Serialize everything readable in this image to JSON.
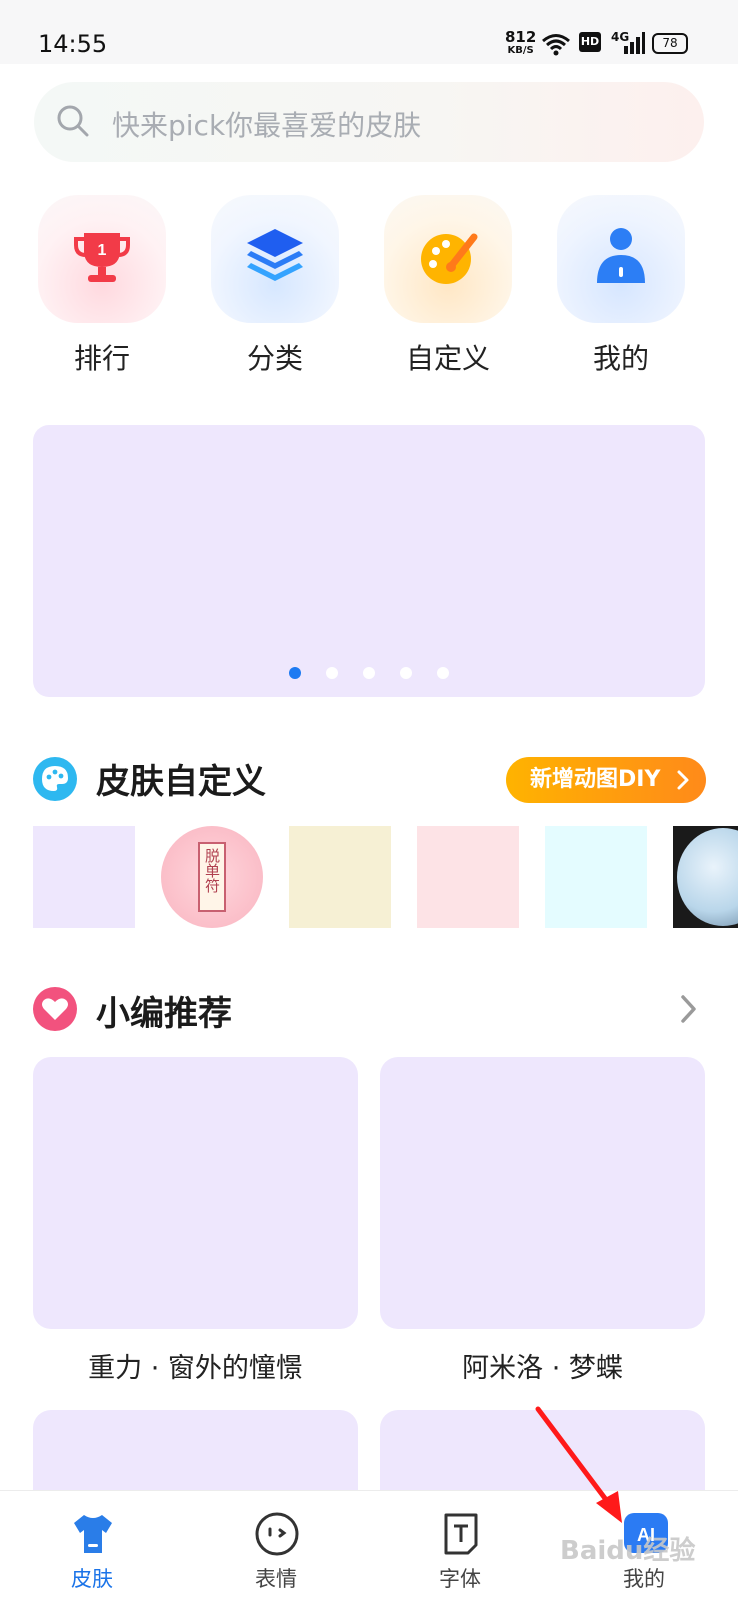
{
  "status": {
    "time": "14:55",
    "net_speed": "812",
    "net_speed_unit": "KB/S",
    "hd": "HD",
    "network": "4G",
    "battery": "78"
  },
  "search": {
    "placeholder": "快来pick你最喜爱的皮肤"
  },
  "quick_entries": [
    {
      "label": "排行",
      "icon": "trophy-icon"
    },
    {
      "label": "分类",
      "icon": "layers-icon"
    },
    {
      "label": "自定义",
      "icon": "palette-icon"
    },
    {
      "label": "我的",
      "icon": "person-icon"
    }
  ],
  "banner": {
    "page_count": 5,
    "active_index": 0
  },
  "section_diy": {
    "title": "皮肤自定义",
    "action_label": "新增动图DIY",
    "skins": [
      {
        "text": ""
      },
      {
        "text": "脱单符"
      },
      {
        "text": ""
      },
      {
        "text": ""
      },
      {
        "text": ""
      },
      {
        "text": ""
      }
    ]
  },
  "section_recommend": {
    "title": "小编推荐",
    "items": [
      {
        "caption": "重力 · 窗外的憧憬"
      },
      {
        "caption": "阿米洛 · 梦蝶"
      }
    ]
  },
  "bottom_nav": [
    {
      "label": "皮肤",
      "active": true
    },
    {
      "label": "表情",
      "active": false
    },
    {
      "label": "字体",
      "active": false
    },
    {
      "label": "我的",
      "active": false
    }
  ],
  "colors": {
    "accent": "#1a73e8",
    "placeholder_tile": "#eee7fd",
    "annotation": "#ff1a1a"
  },
  "watermark": "Baidu经验"
}
